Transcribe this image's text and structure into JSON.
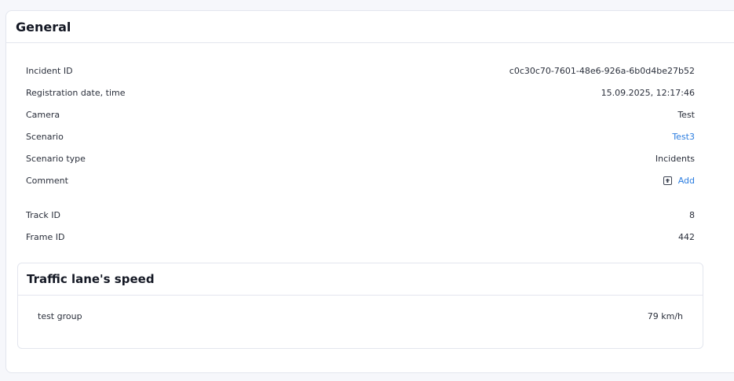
{
  "general": {
    "title": "General",
    "rows": [
      {
        "label": "Incident ID",
        "value": "c0c30c70-7601-48e6-926a-6b0d4be27b52"
      },
      {
        "label": "Registration date, time",
        "value": "15.09.2025, 12:17:46"
      },
      {
        "label": "Camera",
        "value": "Test"
      },
      {
        "label": "Scenario",
        "value": "Test3"
      },
      {
        "label": "Scenario type",
        "value": "Incidents"
      },
      {
        "label": "Comment",
        "value": "Add"
      },
      {
        "label": "Track ID",
        "value": "8"
      },
      {
        "label": "Frame ID",
        "value": "442"
      }
    ]
  },
  "traffic": {
    "title": "Traffic lane's speed",
    "row": {
      "label": "test group",
      "value": "79 km/h"
    }
  },
  "colors": {
    "link": "#2b7de0",
    "border": "#e3e6ee",
    "background": "#f6f7fb"
  },
  "icons": {
    "add": "plus-square-icon"
  }
}
